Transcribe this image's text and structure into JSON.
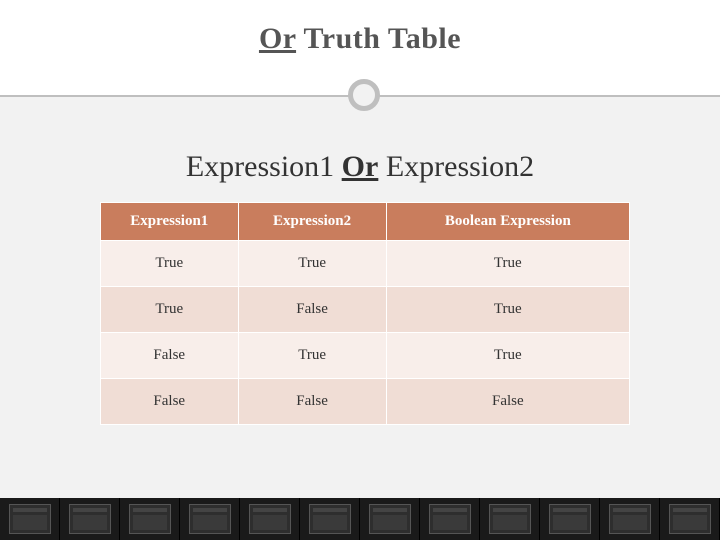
{
  "title": {
    "underlined": "Or",
    "rest": " Truth Table"
  },
  "subtitle": {
    "left": "Expression1 ",
    "keyword": "Or",
    "right": "  Expression2"
  },
  "table": {
    "headers": [
      "Expression1",
      "Expression2",
      "Boolean Expression"
    ],
    "rows": [
      [
        "True",
        "True",
        "True"
      ],
      [
        "True",
        "False",
        "True"
      ],
      [
        "False",
        "True",
        "True"
      ],
      [
        "False",
        "False",
        "False"
      ]
    ]
  },
  "chart_data": {
    "type": "table",
    "title": "Or Truth Table",
    "columns": [
      "Expression1",
      "Expression2",
      "Boolean Expression"
    ],
    "rows": [
      [
        "True",
        "True",
        "True"
      ],
      [
        "True",
        "False",
        "True"
      ],
      [
        "False",
        "True",
        "True"
      ],
      [
        "False",
        "False",
        "False"
      ]
    ]
  }
}
